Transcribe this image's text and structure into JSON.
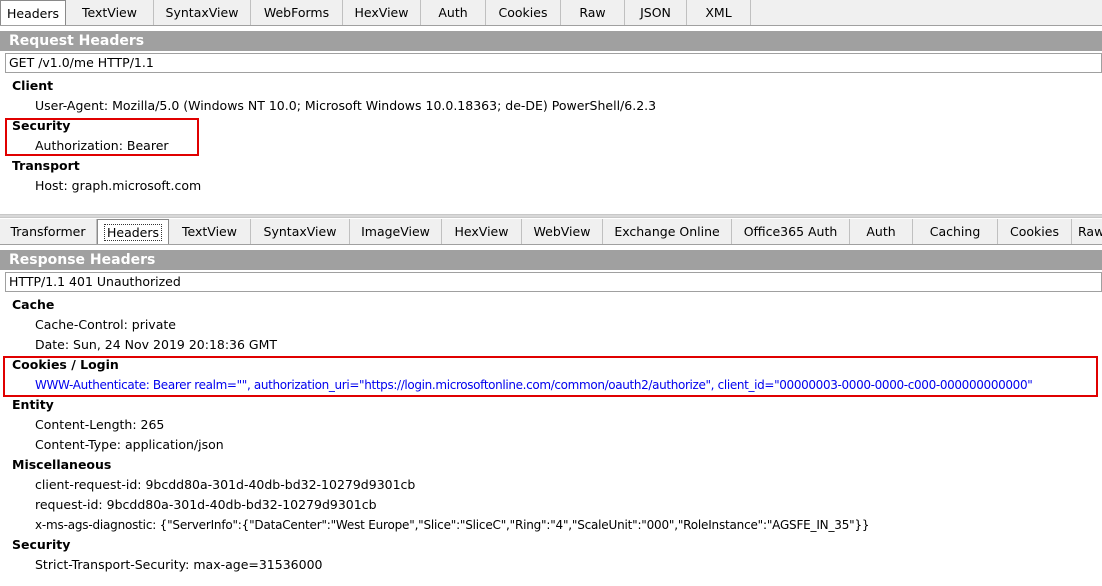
{
  "request": {
    "tabs": [
      "Headers",
      "TextView",
      "SyntaxView",
      "WebForms",
      "HexView",
      "Auth",
      "Cookies",
      "Raw",
      "JSON",
      "XML"
    ],
    "active_tab": "Headers",
    "section_title": "Request Headers",
    "request_line": "GET /v1.0/me HTTP/1.1",
    "groups": [
      {
        "label": "Client",
        "items": [
          "User-Agent: Mozilla/5.0 (Windows NT 10.0; Microsoft Windows 10.0.18363; de-DE) PowerShell/6.2.3"
        ]
      },
      {
        "label": "Security",
        "items": [
          "Authorization: Bearer"
        ]
      },
      {
        "label": "Transport",
        "items": [
          "Host: graph.microsoft.com"
        ]
      }
    ]
  },
  "response": {
    "tabs": [
      "Transformer",
      "Headers",
      "TextView",
      "SyntaxView",
      "ImageView",
      "HexView",
      "WebView",
      "Exchange Online",
      "Office365 Auth",
      "Auth",
      "Caching",
      "Cookies",
      "Raw"
    ],
    "active_tab": "Headers",
    "section_title": "Response Headers",
    "status_line": "HTTP/1.1 401 Unauthorized",
    "groups": [
      {
        "label": "Cache",
        "items": [
          "Cache-Control: private",
          "Date: Sun, 24 Nov 2019 20:18:36 GMT"
        ]
      },
      {
        "label": "Cookies / Login",
        "items": [
          "WWW-Authenticate: Bearer realm=\"\", authorization_uri=\"https://login.microsoftonline.com/common/oauth2/authorize\", client_id=\"00000003-0000-0000-c000-000000000000\""
        ]
      },
      {
        "label": "Entity",
        "items": [
          "Content-Length: 265",
          "Content-Type: application/json"
        ]
      },
      {
        "label": "Miscellaneous",
        "items": [
          "client-request-id: 9bcdd80a-301d-40db-bd32-10279d9301cb",
          "request-id: 9bcdd80a-301d-40db-bd32-10279d9301cb",
          "x-ms-ags-diagnostic: {\"ServerInfo\":{\"DataCenter\":\"West Europe\",\"Slice\":\"SliceC\",\"Ring\":\"4\",\"ScaleUnit\":\"000\",\"RoleInstance\":\"AGSFE_IN_35\"}}"
        ]
      },
      {
        "label": "Security",
        "items": [
          "Strict-Transport-Security: max-age=31536000"
        ]
      }
    ]
  },
  "colors": {
    "section_header_bg": "#a0a0a0",
    "highlight_border": "#e00000",
    "link_text": "#0000ee"
  }
}
